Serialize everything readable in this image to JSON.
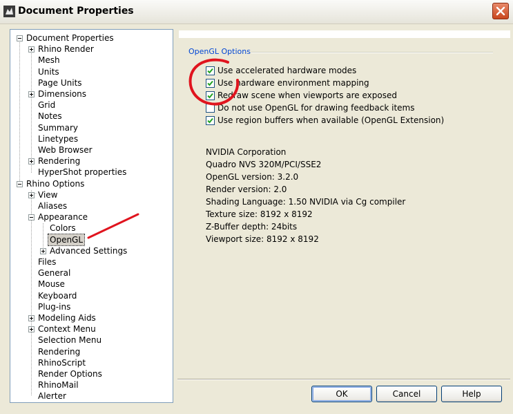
{
  "window": {
    "title": "Document Properties",
    "close_icon": "close-icon"
  },
  "tree": [
    {
      "label": "Document Properties",
      "level": 0,
      "expander": "minus"
    },
    {
      "label": "Rhino Render",
      "level": 1,
      "expander": "plus"
    },
    {
      "label": "Mesh",
      "level": 1
    },
    {
      "label": "Units",
      "level": 1
    },
    {
      "label": "Page Units",
      "level": 1
    },
    {
      "label": "Dimensions",
      "level": 1,
      "expander": "plus"
    },
    {
      "label": "Grid",
      "level": 1
    },
    {
      "label": "Notes",
      "level": 1
    },
    {
      "label": "Summary",
      "level": 1
    },
    {
      "label": "Linetypes",
      "level": 1
    },
    {
      "label": "Web Browser",
      "level": 1
    },
    {
      "label": "Rendering",
      "level": 1,
      "expander": "plus"
    },
    {
      "label": "HyperShot properties",
      "level": 1
    },
    {
      "label": "Rhino Options",
      "level": 0,
      "expander": "minus"
    },
    {
      "label": "View",
      "level": 1,
      "expander": "plus"
    },
    {
      "label": "Aliases",
      "level": 1
    },
    {
      "label": "Appearance",
      "level": 1,
      "expander": "minus"
    },
    {
      "label": "Colors",
      "level": 2
    },
    {
      "label": "OpenGL",
      "level": 2,
      "selected": true
    },
    {
      "label": "Advanced Settings",
      "level": 2,
      "expander": "plus"
    },
    {
      "label": "Files",
      "level": 1
    },
    {
      "label": "General",
      "level": 1
    },
    {
      "label": "Mouse",
      "level": 1
    },
    {
      "label": "Keyboard",
      "level": 1
    },
    {
      "label": "Plug-ins",
      "level": 1
    },
    {
      "label": "Modeling Aids",
      "level": 1,
      "expander": "plus"
    },
    {
      "label": "Context Menu",
      "level": 1,
      "expander": "plus"
    },
    {
      "label": "Selection Menu",
      "level": 1
    },
    {
      "label": "Rendering",
      "level": 1
    },
    {
      "label": "RhinoScript",
      "level": 1
    },
    {
      "label": "Render Options",
      "level": 1
    },
    {
      "label": "RhinoMail",
      "level": 1
    },
    {
      "label": "Alerter",
      "level": 1
    }
  ],
  "opengl": {
    "group_label": "OpenGL Options",
    "options": [
      {
        "label": "Use accelerated hardware modes",
        "checked": true
      },
      {
        "label": "Use hardware environment mapping",
        "checked": true
      },
      {
        "label": "Redraw scene when viewports are exposed",
        "checked": true
      },
      {
        "label": "Do not use OpenGL for drawing feedback items",
        "checked": false
      },
      {
        "label": "Use region buffers when available (OpenGL Extension)",
        "checked": true
      }
    ],
    "info": [
      "NVIDIA Corporation",
      "Quadro NVS 320M/PCI/SSE2",
      "OpenGL version: 3.2.0",
      "Render version: 2.0",
      "Shading Language: 1.50 NVIDIA via Cg compiler",
      "Texture size: 8192 x 8192",
      "Z-Buffer depth: 24bits",
      "Viewport size: 8192 x 8192"
    ]
  },
  "buttons": {
    "ok": "OK",
    "cancel": "Cancel",
    "help": "Help"
  },
  "colors": {
    "annotation": "#e0141e",
    "group_label": "#0046d5",
    "check": "#21a121"
  }
}
